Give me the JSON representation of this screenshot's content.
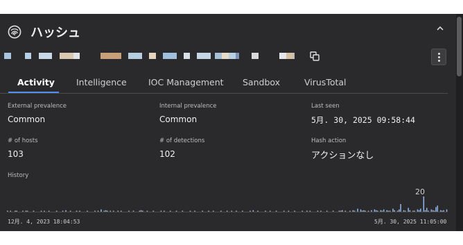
{
  "header": {
    "title": "ハッシュ"
  },
  "hash_blocks": [
    {
      "color": "#a9c4dc"
    },
    {
      "color": "#b7cfe4"
    },
    {
      "color": "#c8d8e6"
    },
    {
      "color": "#d9c9b0"
    },
    {
      "color": "#e0e3e8"
    },
    {
      "color": "#c7a07a"
    },
    {
      "color": "#b6cde0"
    },
    {
      "color": "#e7d5bd"
    },
    {
      "color": "#9fbfdc"
    },
    {
      "color": "#d8e0e8"
    },
    {
      "color": "#c6d6e4"
    },
    {
      "color": "#a8c0d6"
    },
    {
      "color": "#e8dcc8"
    },
    {
      "color": "#b9d0e3"
    },
    {
      "color": "#7c93b5"
    },
    {
      "color": "#d6d9de"
    },
    {
      "color": "#e3e6ea"
    },
    {
      "color": "#d4c1a3"
    },
    {
      "color": "#bcbcbc"
    }
  ],
  "tabs": [
    "Activity",
    "Intelligence",
    "IOC Management",
    "Sandbox",
    "VirusTotal"
  ],
  "fields": {
    "external_prevalence": {
      "label": "External prevalence",
      "value": "Common"
    },
    "internal_prevalence": {
      "label": "Internal prevalence",
      "value": "Common"
    },
    "last_seen": {
      "label": "Last seen",
      "value": "5月. 30, 2025 09:58:44"
    },
    "hosts": {
      "label": "# of hosts",
      "value": "103"
    },
    "detections": {
      "label": "# of detections",
      "value": "102"
    },
    "hash_action": {
      "label": "Hash action",
      "value": "アクションなし"
    }
  },
  "history": {
    "label": "History",
    "peak_label": "20",
    "start_date": "12月. 4, 2023 18:04:53",
    "end_date": "5月. 30, 2025 11:05:00"
  },
  "chart_data": {
    "type": "bar",
    "xlabel": "",
    "ylabel": "",
    "x_range": [
      "12月. 4, 2023 18:04:53",
      "5月. 30, 2025 11:05:00"
    ],
    "ylim": [
      0,
      20
    ],
    "bar_color": "#8fb4e8",
    "values": [
      1,
      0,
      1,
      0,
      0,
      1,
      1,
      0,
      0,
      0,
      1,
      0,
      1,
      1,
      0,
      0,
      0,
      1,
      0,
      0,
      0,
      0,
      1,
      0,
      1,
      0,
      0,
      1,
      0,
      0,
      0,
      0,
      1,
      0,
      0,
      0,
      1,
      0,
      2,
      0,
      0,
      1,
      0,
      0,
      0,
      1,
      0,
      1,
      0,
      0,
      0,
      0,
      1,
      0,
      0,
      0,
      0,
      1,
      0,
      1,
      0,
      3,
      0,
      1,
      2,
      1,
      0,
      1,
      0,
      1,
      0,
      0,
      1,
      0,
      1,
      0,
      0,
      0,
      0,
      1,
      0,
      0,
      1,
      0,
      0,
      0,
      1,
      2,
      1,
      0,
      0,
      1,
      0,
      0,
      0,
      1,
      0,
      0,
      0,
      0,
      1,
      0,
      1,
      0,
      0,
      0,
      1,
      0,
      0,
      0,
      1,
      0,
      0,
      0,
      1,
      0,
      0,
      0,
      0,
      1,
      0,
      0,
      1,
      0,
      0,
      0,
      0,
      1,
      0,
      0,
      0,
      1,
      0,
      0,
      1,
      0,
      0,
      0,
      0,
      1,
      0,
      0,
      0,
      1,
      0,
      0,
      1,
      0,
      0,
      1,
      0,
      0,
      0,
      1,
      0,
      0,
      0,
      0,
      1,
      0,
      2,
      0,
      0,
      1,
      0,
      0,
      0,
      0,
      1,
      0,
      0,
      1,
      0,
      0,
      0,
      1,
      0,
      0,
      0,
      0,
      1,
      0,
      0,
      1,
      0,
      0,
      0,
      1,
      0,
      0,
      0,
      0,
      1,
      0,
      0,
      1,
      0,
      1,
      0,
      0,
      0,
      0,
      1,
      0,
      1,
      0,
      0,
      0,
      1,
      0,
      0,
      0,
      1,
      0,
      0,
      0,
      1,
      1,
      2,
      0,
      1,
      0,
      0,
      1,
      0,
      2,
      1,
      0,
      4,
      0,
      3,
      1,
      2,
      1,
      0,
      1,
      0,
      2,
      0,
      3,
      2,
      1,
      0,
      2,
      1,
      3,
      0,
      2,
      1,
      1,
      0,
      4,
      2,
      0,
      1,
      3,
      10,
      0,
      2,
      1,
      0,
      5,
      2,
      0,
      1,
      1,
      0,
      3,
      2,
      4,
      0,
      20,
      2,
      5,
      1,
      0,
      3,
      2,
      1,
      6,
      8,
      0,
      2,
      1,
      2,
      0,
      3
    ]
  }
}
